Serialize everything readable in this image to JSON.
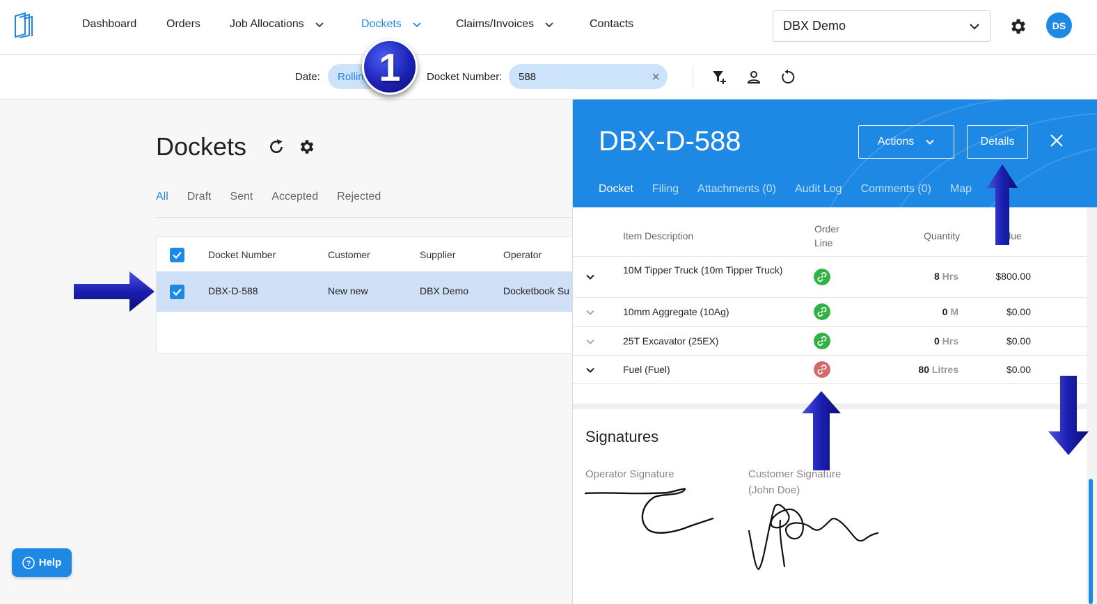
{
  "nav": {
    "items": [
      {
        "label": "Dashboard"
      },
      {
        "label": "Orders"
      },
      {
        "label": "Job Allocations"
      },
      {
        "label": "Dockets"
      },
      {
        "label": "Claims/Invoices"
      },
      {
        "label": "Contacts"
      }
    ],
    "org_select": "DBX Demo",
    "avatar_initials": "DS"
  },
  "filters": {
    "date_label": "Date:",
    "date_value": "Rolling",
    "docket_label": "Docket Number:",
    "docket_value": "588"
  },
  "annotation": {
    "step": "1"
  },
  "main": {
    "title": "Dockets",
    "tabs": [
      "All",
      "Draft",
      "Sent",
      "Accepted",
      "Rejected"
    ],
    "columns": [
      "Docket Number",
      "Customer",
      "Supplier",
      "Operator"
    ],
    "rows": [
      {
        "docket_number": "DBX-D-588",
        "customer": "New new",
        "supplier": "DBX Demo",
        "operator": "Docketbook Su"
      }
    ]
  },
  "help": {
    "label": "Help"
  },
  "drawer": {
    "title": "DBX-D-588",
    "actions_label": "Actions",
    "details_label": "Details",
    "tabs": [
      "Docket",
      "Filing",
      "Attachments (0)",
      "Audit Log",
      "Comments (0)",
      "Map"
    ],
    "columns": {
      "description": "Item Description",
      "order_line_1": "Order",
      "order_line_2": "Line",
      "quantity": "Quantity",
      "value": "Value"
    },
    "items": [
      {
        "description": "10M Tipper Truck (10m Tipper Truck)",
        "qty": "8",
        "unit": "Hrs",
        "value": "$800.00",
        "linked": true
      },
      {
        "description": "10mm Aggregate (10Ag)",
        "qty": "0",
        "unit": "M",
        "value": "$0.00",
        "linked": true
      },
      {
        "description": "25T Excavator (25EX)",
        "qty": "0",
        "unit": "Hrs",
        "value": "$0.00",
        "linked": true
      },
      {
        "description": "Fuel (Fuel)",
        "qty": "80",
        "unit": "Litres",
        "value": "$0.00",
        "linked": false
      }
    ],
    "signatures": {
      "title": "Signatures",
      "operator_label": "Operator Signature",
      "customer_label_1": "Customer Signature",
      "customer_label_2": "(John Doe)"
    }
  },
  "colors": {
    "primary": "#1e88e5",
    "row_selected": "#cfe0f7",
    "linked_green": "#2fb344",
    "unlinked_red": "#d46a6a",
    "annotation_blue": "#1c22b8"
  }
}
